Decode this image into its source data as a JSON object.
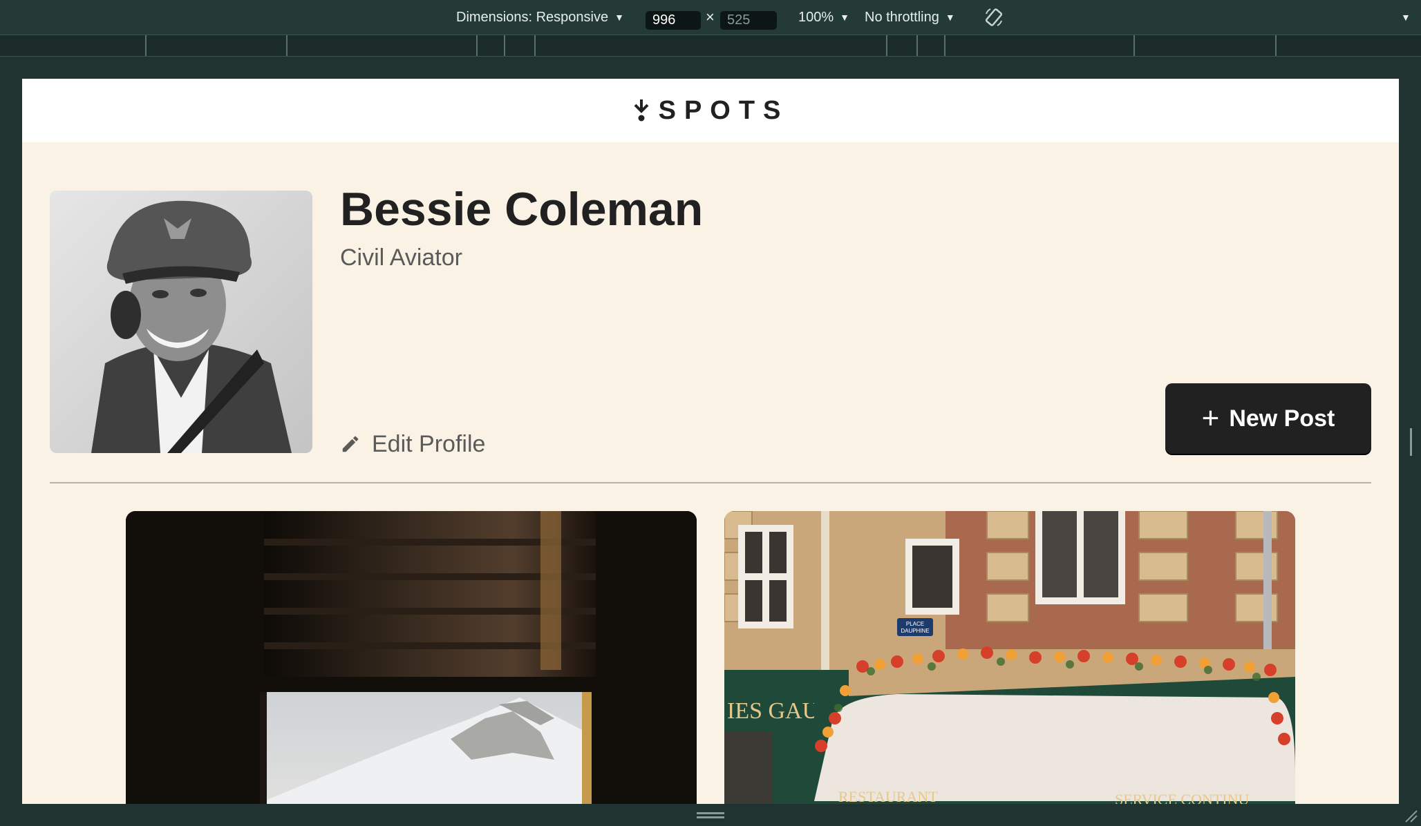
{
  "devtools": {
    "dimensions_label": "Dimensions: Responsive",
    "width_value": "996",
    "height_value": "525",
    "times_symbol": "×",
    "zoom_label": "100%",
    "throttling_label": "No throttling",
    "caret": "▼"
  },
  "header": {
    "logo_text": "SPOTS"
  },
  "profile": {
    "name": "Bessie Coleman",
    "description": "Civil Aviator",
    "edit_label": "Edit Profile",
    "new_post_label": "New Post",
    "plus_symbol": "+"
  },
  "cards": [
    {
      "kind": "window-mountain-photo"
    },
    {
      "kind": "restaurant-facade-photo",
      "signs": {
        "shop": "IES GAUBERT",
        "left": "RESTAURANT",
        "right": "SERVICE CONTINU",
        "plaque_top": "PLACE",
        "plaque_bottom": "DAUPHINE"
      }
    }
  ],
  "colors": {
    "page_bg": "#faf3e5",
    "header_bg": "#ffffff",
    "text_dark": "#212121",
    "text_muted": "#5a5a5a",
    "button_bg": "#212121",
    "devtools_bg": "#233a36"
  }
}
